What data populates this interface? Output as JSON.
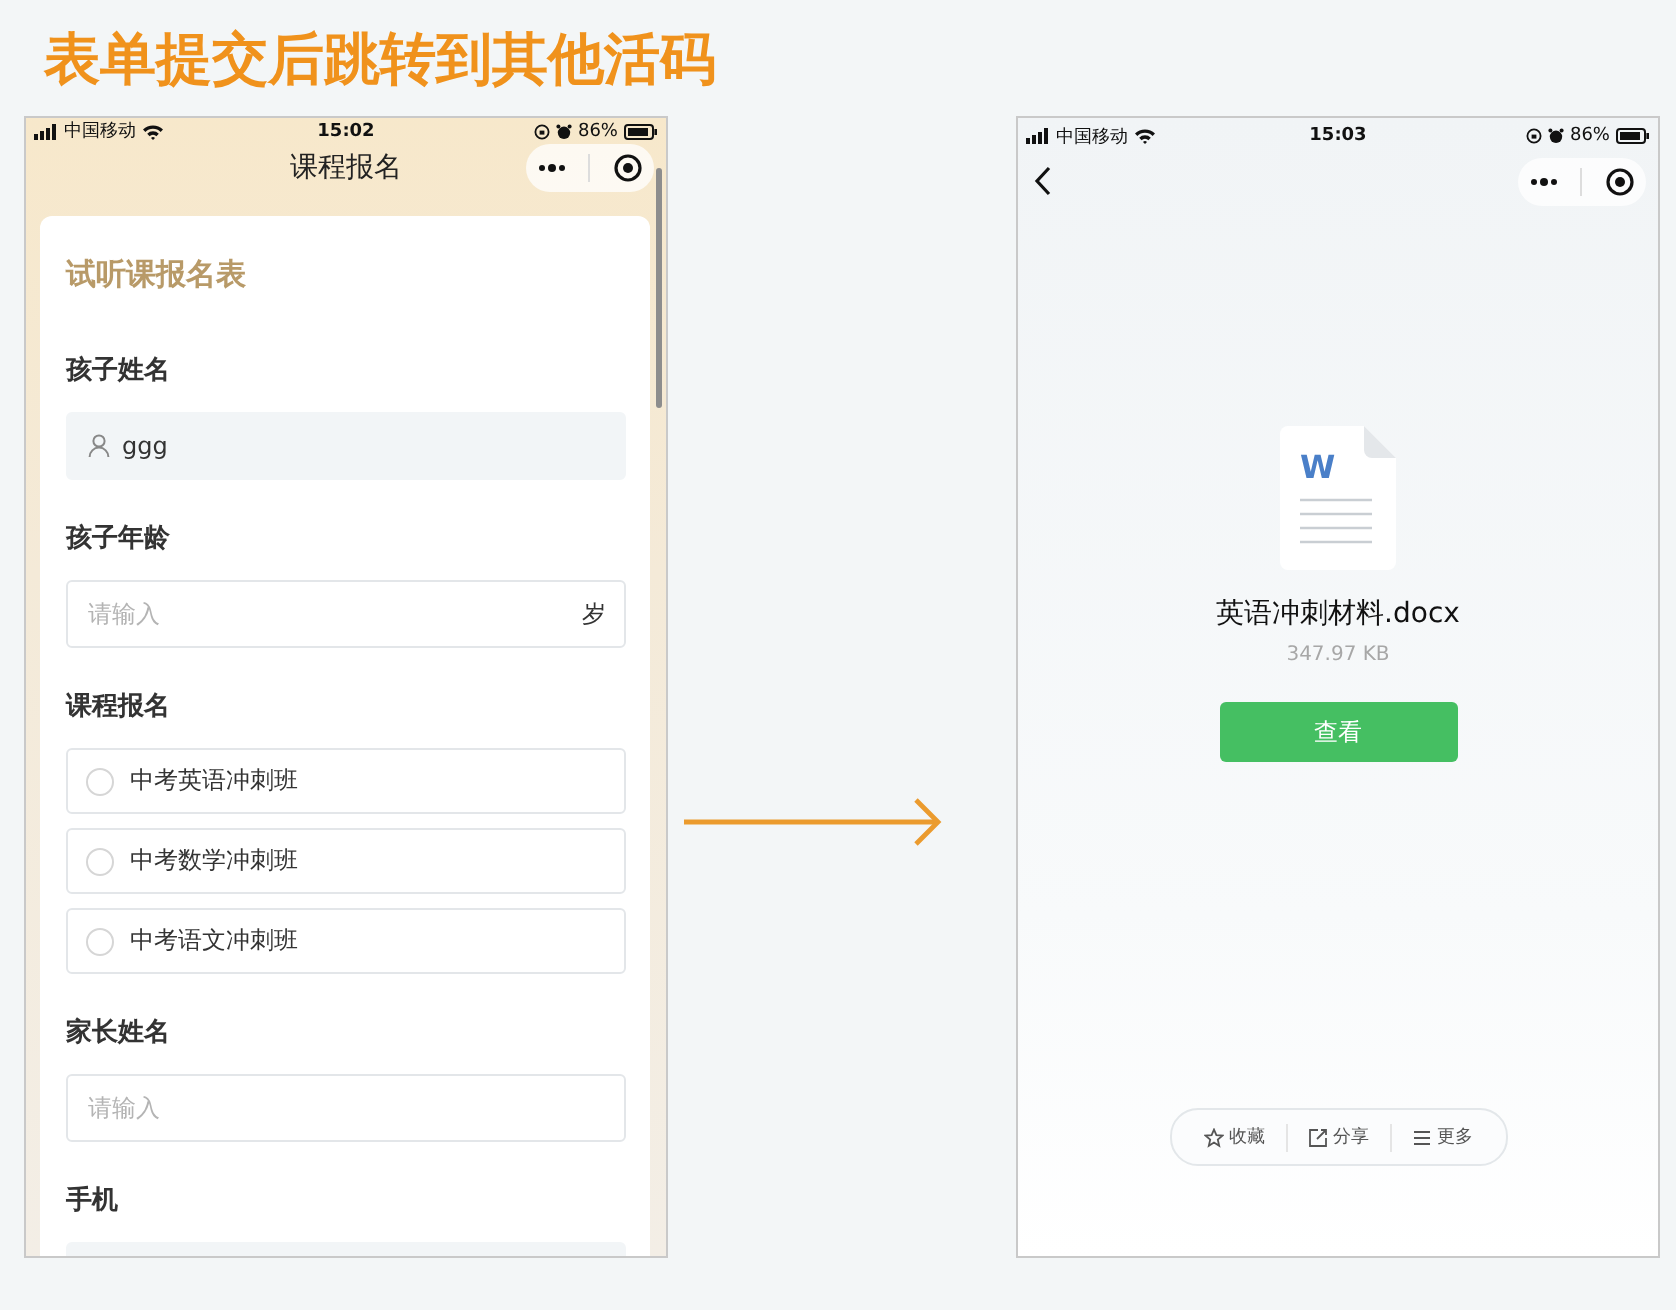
{
  "title": "表单提交后跳转到其他活码",
  "form_screen": {
    "status_bar": {
      "carrier": "中国移动",
      "time": "15:02",
      "battery": "86%"
    },
    "nav_title": "课程报名",
    "form": {
      "title": "试听课报名表",
      "fields": [
        {
          "kind": "text",
          "label": "孩子姓名",
          "value": "ggg"
        },
        {
          "kind": "input",
          "label": "孩子年龄",
          "placeholder": "请输入",
          "suffix": "岁"
        },
        {
          "kind": "radio",
          "label": "课程报名",
          "options": [
            {
              "label": "中考英语冲刺班",
              "selected": false
            },
            {
              "label": "中考数学冲刺班",
              "selected": false
            },
            {
              "label": "中考语文冲刺班",
              "selected": false
            }
          ]
        },
        {
          "kind": "input",
          "label": "家长姓名",
          "placeholder": "请输入"
        },
        {
          "kind": "blank",
          "label": "手机"
        }
      ]
    }
  },
  "file_screen": {
    "status_bar": {
      "carrier": "中国移动",
      "time": "15:03",
      "battery": "86%"
    },
    "file": {
      "type_letter": "W",
      "name": "英语冲刺材料.docx",
      "size": "347.97 KB"
    },
    "view_button": "查看",
    "actions": [
      {
        "kind": "star",
        "label": "收藏"
      },
      {
        "kind": "share",
        "label": "分享"
      },
      {
        "kind": "menu",
        "label": "更多"
      }
    ]
  }
}
